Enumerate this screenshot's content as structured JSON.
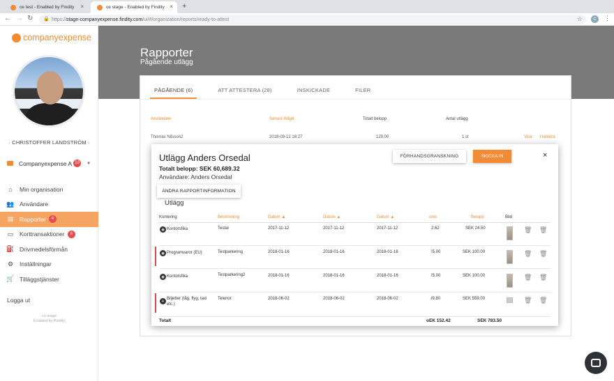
{
  "browser": {
    "tabs": [
      {
        "label": "ce test - Enabled by Findity"
      },
      {
        "label": "ce stage - Enabled by Findity"
      }
    ],
    "new_tab": "+",
    "close": "×",
    "url_prefix": "https://",
    "url_host": "stage-companyexpense.findity.com",
    "url_path": "/ui/#/organization/reports/ready-to-attest",
    "profile_initial": "C"
  },
  "sidebar": {
    "logo_text": "companyexpense",
    "username": "· CHRISTOFFER LANDSTRÖM ·",
    "org": {
      "name": "Companyexpense A",
      "badge": "16"
    },
    "items": [
      {
        "label": "Min organisation",
        "icon": "home-icon",
        "glyph": "⌂"
      },
      {
        "label": "Användare",
        "icon": "users-icon",
        "glyph": "👥"
      },
      {
        "label": "Rapporter",
        "icon": "report-icon",
        "glyph": "▤",
        "badge": "4"
      },
      {
        "label": "Korttransaktioner",
        "icon": "card-icon",
        "glyph": "▭",
        "badge": "6"
      },
      {
        "label": "Drivmedelsförmån",
        "icon": "fuel-icon",
        "glyph": "⛽"
      },
      {
        "label": "Inställningar",
        "icon": "gear-icon",
        "glyph": "⚙"
      },
      {
        "label": "Tilläggstjänster",
        "icon": "cart-icon",
        "glyph": "🛒"
      }
    ],
    "logout": "Logga ut",
    "footer_line1": "ce stage",
    "footer_line2": "Enabled by Findity"
  },
  "page": {
    "title": "Rapporter",
    "subtitle": "Pågående utlägg",
    "tabs": [
      "PÅGÅENDE (6)",
      "ATT ATTESTERA (28)",
      "INSKICKADE",
      "FILER"
    ],
    "bg_headers": [
      "Användare",
      "Senast ifrågd",
      "Totalt belopp",
      "Antal utlägg"
    ],
    "bg_row": {
      "user": "Thomas Nilsson2",
      "date": "2018-09-12 16:27",
      "amount": "129.00",
      "count": "1 st",
      "view": "Visa",
      "handle": "Hantera"
    }
  },
  "modal": {
    "title": "Utlägg Anders Orsedal",
    "total": "Totalt belopp: SEK 60,689.32",
    "user": "Användare: Anders Orsedal",
    "preview_button": "FÖRHANDSGRANSKNING",
    "submit_button": "SKICKA IN",
    "close": "×",
    "edit_button": "ÄNDRA RAPPORTINFORMATION",
    "section": "Utlägg",
    "headers": [
      "Kontering",
      "Beskrivning",
      "Datum ▲",
      "Datum ▲",
      "Datum ▲",
      "oms",
      "Belopp",
      "Bild"
    ],
    "rows": [
      {
        "account": "Kontorsfika",
        "desc": "Testar",
        "d1": "2017-11-12",
        "d2": "2017-11-12",
        "d3": "2017-11-12",
        "vat": "2.62",
        "amount": "SEK 24.50",
        "flag": false,
        "img": "full"
      },
      {
        "account": "Programvaror (EU)",
        "desc": "Testparkering",
        "d1": "2018-01-16",
        "d2": "2018-01-16",
        "d3": "2018-01-16",
        "vat": "!5.00",
        "amount": "SEK 100.00",
        "flag": true,
        "img": "full"
      },
      {
        "account": "Kontorsfika",
        "desc": "Testparkering2",
        "d1": "2018-01-16",
        "d2": "2018-01-16",
        "d3": "2018-01-16",
        "vat": "!5.00",
        "amount": "SEK 100.00",
        "flag": false,
        "img": "full"
      },
      {
        "account": "Biljetter (tåg, flyg, taxi etc.)",
        "desc": "Telenor",
        "d1": "2018-06-02",
        "d2": "2018-06-02",
        "d3": "2018-06-02",
        "vat": "i9.80",
        "amount": "SEK 559.00",
        "flag": true,
        "img": "small"
      }
    ],
    "total_label": "Totalt",
    "total_vat": "oEK 152.42",
    "total_amount": "SEK 783.50"
  }
}
